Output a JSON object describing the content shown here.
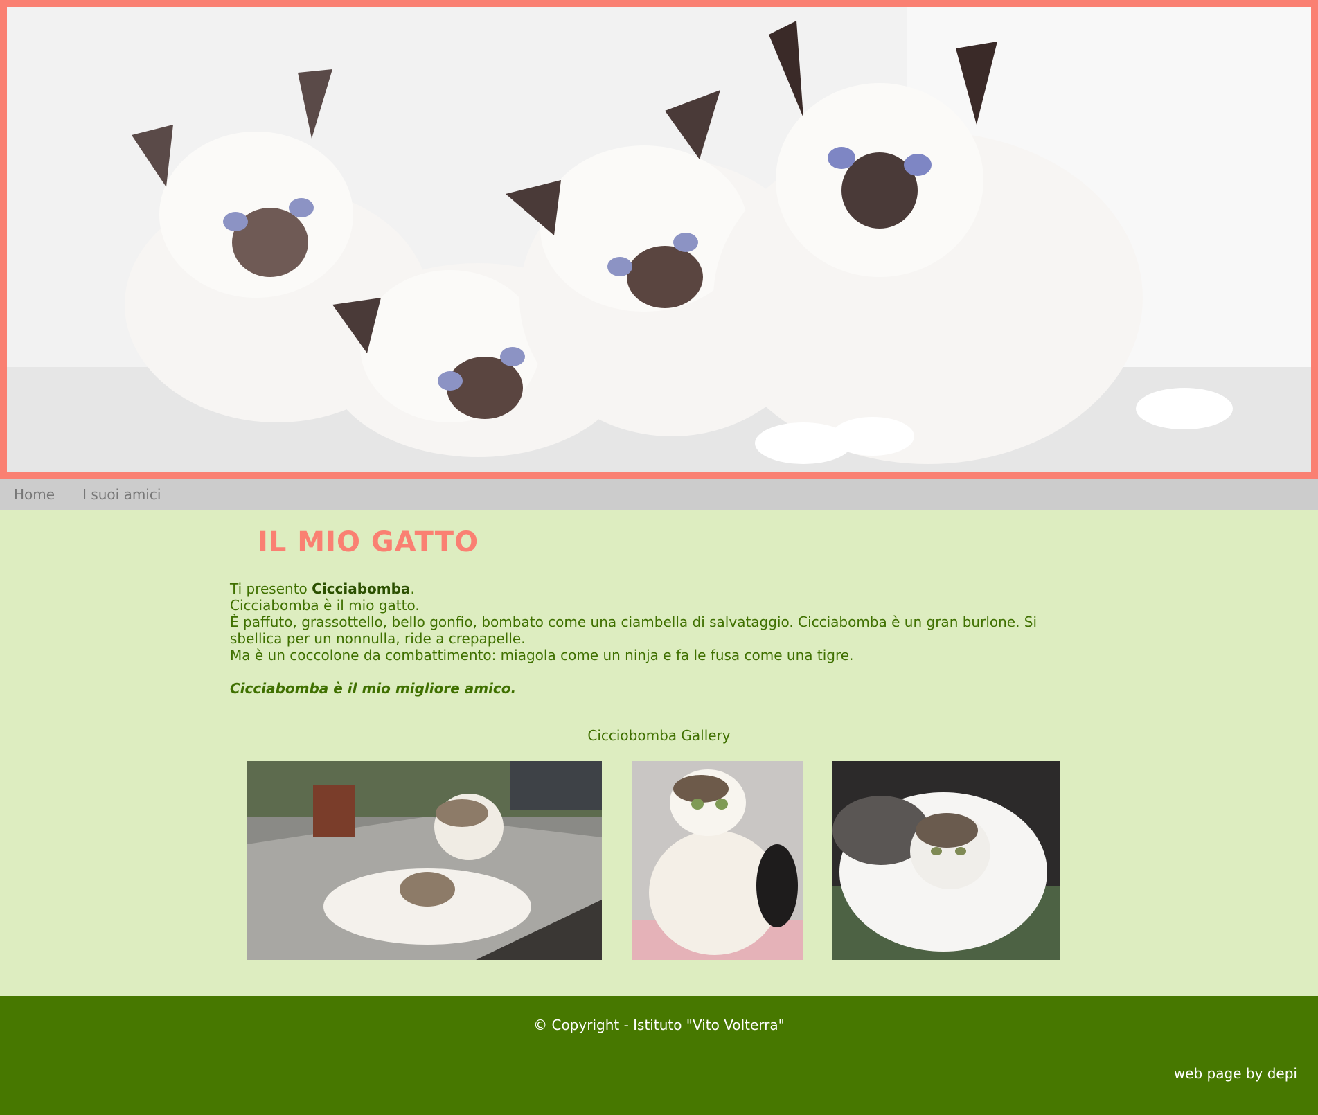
{
  "banner": {
    "alt": "kittens-banner"
  },
  "nav": {
    "items": [
      {
        "label": "Home"
      },
      {
        "label": "I suoi amici"
      }
    ]
  },
  "main": {
    "title": "IL MIO GATTO",
    "intro_prefix": "Ti presento ",
    "intro_name": "Cicciabomba",
    "intro_suffix": ".",
    "line2": "Cicciabomba è il mio gatto.",
    "line3": "È paffuto, grassottello, bello gonfio, bombato come una ciambella di salvataggio. Cicciabomba è un gran burlone. Si sbellica per un nonnulla, ride a crepapelle.",
    "line4": "Ma è un coccolone da combattimento: miagola come un ninja e fa le fusa come una tigre.",
    "motto": "Cicciabomba è il mio migliore amico."
  },
  "gallery": {
    "caption": "Cicciobomba Gallery"
  },
  "footer": {
    "copyright": "© Copyright - Istituto \"Vito Volterra\"",
    "credit": "web page by depi"
  },
  "colors": {
    "accent": "#fa8072",
    "green_text": "#3f7000",
    "footer_bg": "#477800",
    "page_bg": "#ddedc0",
    "nav_bg": "#cccccc"
  }
}
